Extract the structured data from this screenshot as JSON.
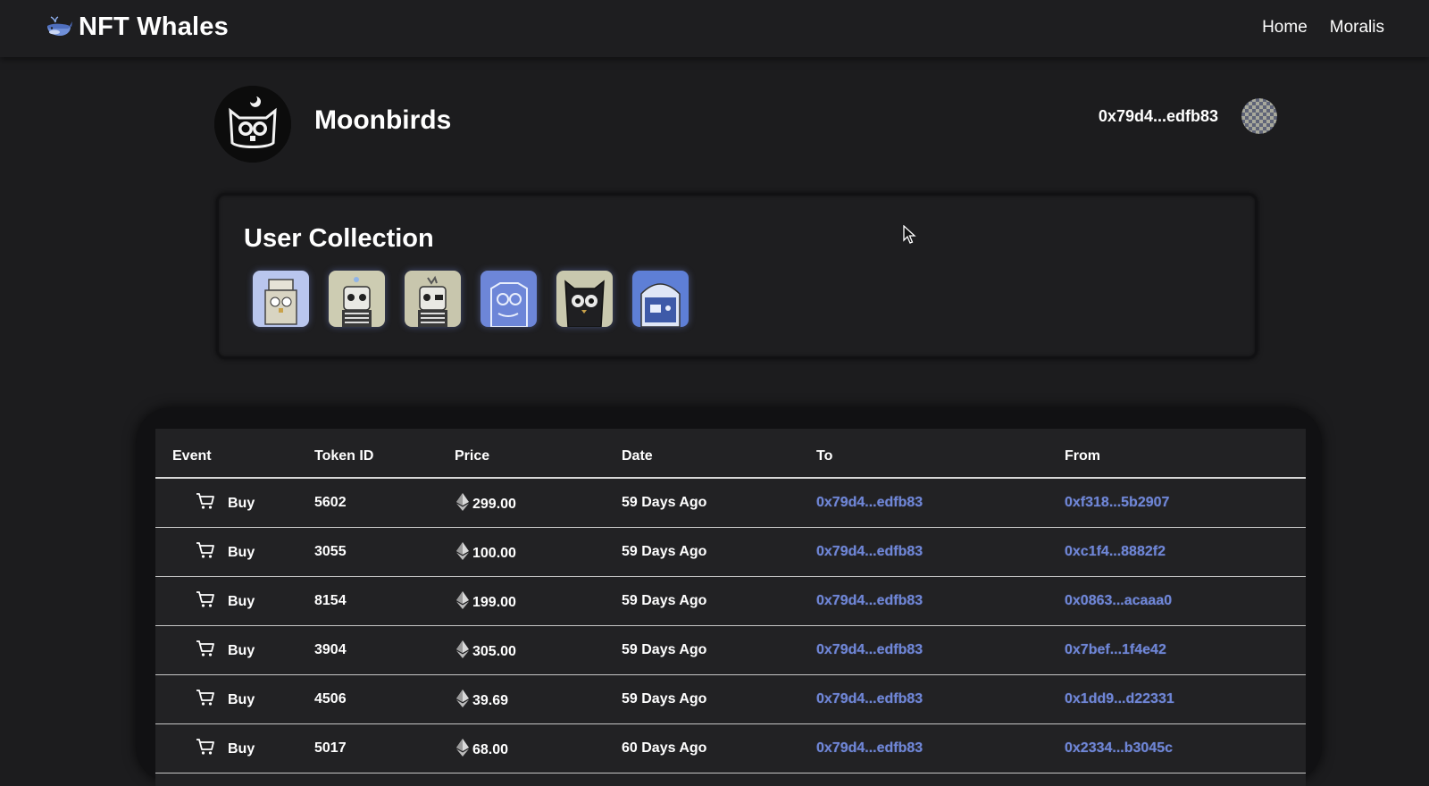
{
  "navbar": {
    "brand_title": "NFT Whales",
    "brand_icon": "whale-icon",
    "links": [
      "Home",
      "Moralis"
    ]
  },
  "collection": {
    "name": "Moonbirds",
    "logo_icon": "owl-icon",
    "wallet_address": "0x79d4...edfb83",
    "avatar_icon": "checkered-avatar"
  },
  "user_collection": {
    "title": "User Collection",
    "items": [
      {
        "icon": "moonbird-crown-icon",
        "bg": "#b9c6ee"
      },
      {
        "icon": "moonbird-skull-icon",
        "bg": "#cdccb2"
      },
      {
        "icon": "moonbird-skull-icon",
        "bg": "#c8c6ad"
      },
      {
        "icon": "moonbird-blue-icon",
        "bg": "#6d86d8"
      },
      {
        "icon": "moonbird-dark-icon",
        "bg": "#c9c8ae"
      },
      {
        "icon": "moonbird-helmet-icon",
        "bg": "#5e7fd6"
      }
    ]
  },
  "table": {
    "headers": {
      "event": "Event",
      "token_id": "Token ID",
      "price": "Price",
      "date": "Date",
      "to": "To",
      "from": "From"
    },
    "rows": [
      {
        "event": "Buy",
        "token_id": "5602",
        "price": "299.00",
        "date": "59 Days Ago",
        "to": "0x79d4...edfb83",
        "from": "0xf318...5b2907"
      },
      {
        "event": "Buy",
        "token_id": "3055",
        "price": "100.00",
        "date": "59 Days Ago",
        "to": "0x79d4...edfb83",
        "from": "0xc1f4...8882f2"
      },
      {
        "event": "Buy",
        "token_id": "8154",
        "price": "199.00",
        "date": "59 Days Ago",
        "to": "0x79d4...edfb83",
        "from": "0x0863...acaaa0"
      },
      {
        "event": "Buy",
        "token_id": "3904",
        "price": "305.00",
        "date": "59 Days Ago",
        "to": "0x79d4...edfb83",
        "from": "0x7bef...1f4e42"
      },
      {
        "event": "Buy",
        "token_id": "4506",
        "price": "39.69",
        "date": "59 Days Ago",
        "to": "0x79d4...edfb83",
        "from": "0x1dd9...d22331"
      },
      {
        "event": "Buy",
        "token_id": "5017",
        "price": "68.00",
        "date": "60 Days Ago",
        "to": "0x79d4...edfb83",
        "from": "0x2334...b3045c"
      }
    ]
  },
  "colors": {
    "background": "#1c1c1e",
    "address_link": "#6f86d6",
    "text": "#ffffff"
  }
}
